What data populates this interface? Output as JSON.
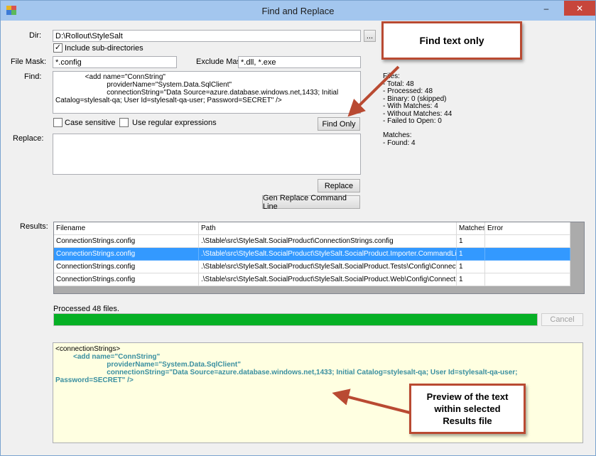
{
  "window": {
    "title": "Find and Replace"
  },
  "form": {
    "dir_label": "Dir:",
    "dir_value": "D:\\Rollout\\StyleSalt",
    "browse_label": "...",
    "include_subdirs_label": "Include sub-directories",
    "include_subdirs_checked": "✓",
    "file_mask_label": "File Mask:",
    "file_mask_value": "*.config",
    "exclude_mask_label": "Exclude Mask:",
    "exclude_mask_value": "*.dll, *.exe",
    "find_label": "Find:",
    "find_value": "               <add name=\"ConnString\"\n                          providerName=\"System.Data.SqlClient\"\n                          connectionString=\"Data Source=azure.database.windows.net,1433; Initial\nCatalog=stylesalt-qa; User Id=stylesalt-qa-user; Password=SECRET\" />",
    "case_sensitive_label": "Case sensitive",
    "regex_label": "Use regular expressions",
    "find_only_label": "Find Only",
    "replace_label": "Replace:",
    "replace_value": "",
    "replace_button_label": "Replace",
    "gen_command_label": "Gen Replace Command Line"
  },
  "stats": {
    "files": "Files:\n- Total: 48\n- Processed: 48\n- Binary: 0 (skipped)\n- With Matches: 4\n- Without Matches: 44\n- Failed to Open: 0",
    "matches": "Matches:\n- Found: 4"
  },
  "results": {
    "label": "Results:",
    "columns": [
      "Filename",
      "Path",
      "Matches",
      "Error"
    ],
    "rows": [
      [
        "ConnectionStrings.config",
        ".\\Stable\\src\\StyleSalt.SocialProduct\\ConnectionStrings.config",
        "1",
        ""
      ],
      [
        "ConnectionStrings.config",
        ".\\Stable\\src\\StyleSalt.SocialProduct\\StyleSalt.SocialProduct.Importer.CommandLine\\config...",
        "1",
        ""
      ],
      [
        "ConnectionStrings.config",
        ".\\Stable\\src\\StyleSalt.SocialProduct\\StyleSalt.SocialProduct.Tests\\Config\\ConnectionStrin...",
        "1",
        ""
      ],
      [
        "ConnectionStrings.config",
        ".\\Stable\\src\\StyleSalt.SocialProduct\\StyleSalt.SocialProduct.Web\\Config\\ConnectionStrin...",
        "1",
        ""
      ]
    ],
    "selected_row": 1
  },
  "progress": {
    "status": "Processed 48 files.",
    "fraction": 1.0,
    "cancel_label": "Cancel"
  },
  "preview": {
    "line1": "<connectionStrings>",
    "line2": "         <add name=\"ConnString\"",
    "line3": "                          providerName=\"System.Data.SqlClient\"",
    "line4": "                          connectionString=\"Data Source=azure.database.windows.net,1433; Initial Catalog=stylesalt-qa; User Id=stylesalt-qa-user;",
    "line5": "Password=SECRET\" />"
  },
  "callouts": {
    "find_text_only": "Find text only",
    "preview_text": "Preview of the text\nwithin selected\nResults file"
  },
  "colors": {
    "accent": "#3399ff",
    "progress": "#06b025",
    "callout_border": "#b94a32",
    "preview_bg": "#ffffe1"
  }
}
